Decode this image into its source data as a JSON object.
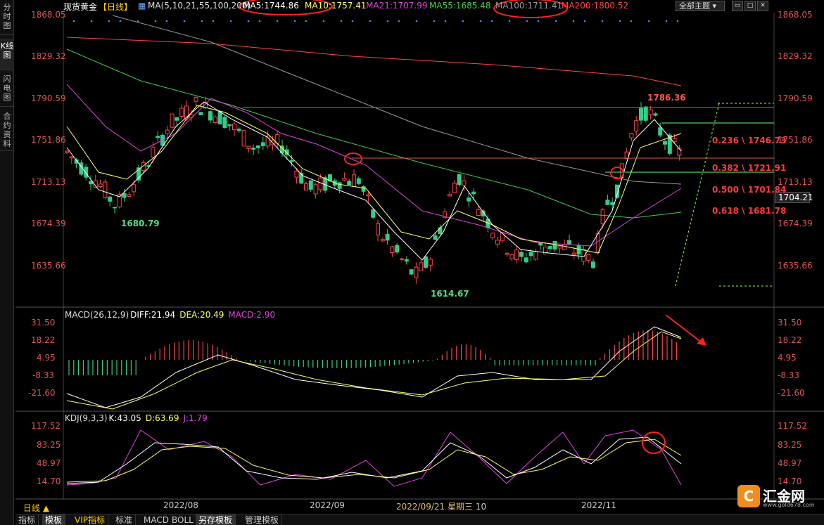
{
  "sidebar": {
    "tabs": [
      {
        "label": "分时图"
      },
      {
        "label": "K线图"
      },
      {
        "label": "闪电图"
      },
      {
        "label": "合约资料"
      }
    ]
  },
  "header": {
    "instrument": "现货黄金",
    "period_tag": "【日线】",
    "ma_title": "MA(5,10,21,55,100,200)",
    "ma5": "MA5:1744.86",
    "ma10": "MA10:1757.41",
    "ma21": "MA21:1707.99",
    "ma55": "MA55:1685.48",
    "ma100": "MA100:1711.41",
    "ma200": "MA200:1800.52",
    "theme_button": "全部主题",
    "colors": {
      "ma5": "#ffffff",
      "ma10": "#ffff66",
      "ma21": "#dd44dd",
      "ma55": "#44cc44",
      "ma100": "#999999",
      "ma200": "#ff4444",
      "up": "#ff4444",
      "down": "#33cc88"
    }
  },
  "price_axis": {
    "labels": [
      "1868.05",
      "1829.32",
      "1790.59",
      "1751.86",
      "1713.13",
      "1674.39",
      "1635.66"
    ],
    "current": "1704.21"
  },
  "annotations": {
    "high": "1786.36",
    "low1": "1680.79",
    "low2": "1614.67"
  },
  "fib": [
    {
      "label": "0.236 \\ 1746.73"
    },
    {
      "label": "0.382 \\ 1721.91"
    },
    {
      "label": "0.500 \\ 1701.84"
    },
    {
      "label": "0.618 \\ 1681.78"
    }
  ],
  "macd": {
    "title": "MACD(26,12,9)",
    "diff": "DIFF:21.94",
    "dea": "DEA:20.49",
    "macd": "MACD:2.90",
    "axis": [
      "31.50",
      "18.22",
      "4.95",
      "-8.33",
      "-21.60"
    ]
  },
  "kdj": {
    "title": "KDJ(9,3,3)",
    "k": "K:43.05",
    "d": "D:63.69",
    "j": "J:1.79",
    "axis": [
      "117.52",
      "83.25",
      "48.97",
      "14.70"
    ]
  },
  "dates": {
    "d1": "2022/08",
    "d2": "2022/09",
    "cursor": "2022/09/21 星期三",
    "cursor_suffix": "10",
    "d3": "2022/11"
  },
  "period_label": "日线 ▲",
  "bottom_tabs": [
    "指标",
    "模板",
    "VIP指标",
    "标准",
    "MACD",
    "BOLL",
    "另存模板",
    "管理模板"
  ],
  "logo": {
    "name": "汇金网",
    "url": "www.gold678.com",
    "glyph": "C"
  }
}
